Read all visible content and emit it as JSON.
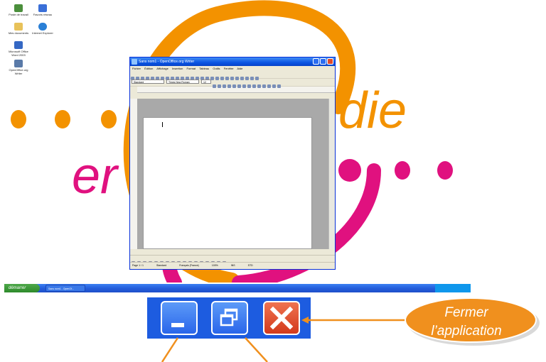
{
  "desktop": {
    "icons": [
      {
        "label": "Poste de travail",
        "color": "#4b8f3c"
      },
      {
        "label": "Favoris réseau",
        "color": "#3a6fd8"
      },
      {
        "label": "Mes documents",
        "color": "#e8c25a"
      },
      {
        "label": "Internet Explorer",
        "color": "#2a7fd6"
      },
      {
        "label": "Microsoft Office Word 2003",
        "color": "#3568c4"
      },
      {
        "label": "OpenOffice.org Writer",
        "color": "#5a7aa8"
      }
    ],
    "wallpaper": {
      "left_word": "er",
      "right_word": "die",
      "pink": "#e0117f",
      "orange": "#f39200"
    }
  },
  "writer_window": {
    "title": "Sans nom1 - OpenOffice.org Writer",
    "menu": [
      "Fichier",
      "Édition",
      "Affichage",
      "Insertion",
      "Format",
      "Tableau",
      "Outils",
      "Fenêtre",
      "Aide"
    ],
    "style_value": "Standard",
    "font_value": "Times New Roman",
    "size_value": "12",
    "status": {
      "page": "Page 1 / 1",
      "style": "Standard",
      "language": "Français (France)",
      "zoom": "100%",
      "mode": "INS",
      "std": "STD"
    }
  },
  "taskbar": {
    "start_label": "démarrer",
    "task_label": "Sans nom1 - OpenOf..."
  },
  "zoom_buttons": {
    "minimize_icon": "minimize-icon",
    "restore_icon": "restore-icon",
    "close_icon": "close-icon"
  },
  "callout": {
    "line1": "Fermer",
    "line2": "l’application",
    "fill": "#f0901e"
  }
}
